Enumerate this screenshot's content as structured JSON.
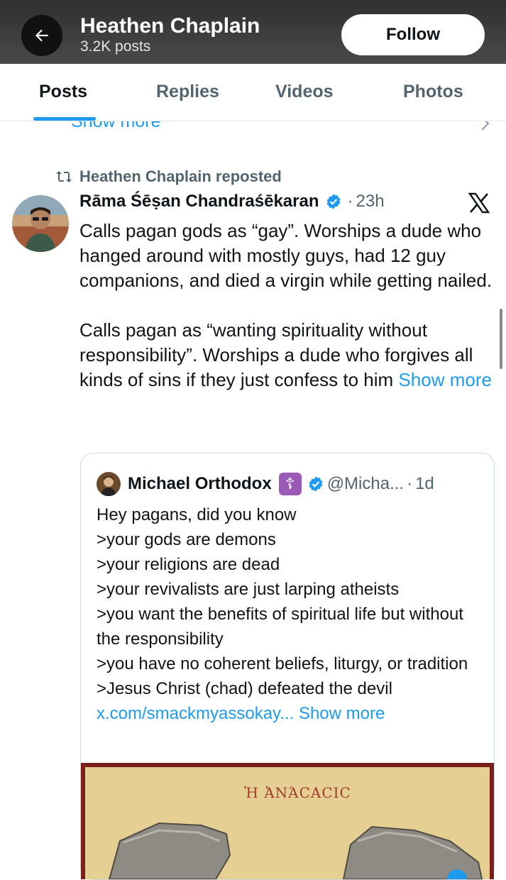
{
  "header": {
    "title": "Heathen Chaplain",
    "subtitle": "3.2K posts",
    "follow_label": "Follow"
  },
  "tabs": [
    {
      "label": "Posts",
      "active": true
    },
    {
      "label": "Replies"
    },
    {
      "label": "Videos"
    },
    {
      "label": "Photos"
    }
  ],
  "prev_post": {
    "show_more": "Show more"
  },
  "post": {
    "repost_label": "Heathen Chaplain reposted",
    "author": "Rāma Śēṣan Chandraśēkaran",
    "time": "23h",
    "text_p1": "Calls pagan gods as “gay”. Worships a dude who hanged around with mostly guys, had 12 guy companions, and died a virgin while getting nailed.",
    "text_p2": "Calls pagan as “wanting spirituality without responsibility”. Worships a dude who forgives all kinds of sins if they just confess to him",
    "show_more": "Show more",
    "quote": {
      "author": "Michael Orthodox",
      "badge": "☦",
      "handle": "@Micha...",
      "time": "1d",
      "lines": [
        "Hey pagans, did you know",
        ">your gods are demons",
        ">your religions are dead",
        ">your revivalists are just larping atheists",
        ">you want the benefits of spiritual life but without the responsibility",
        ">you have no coherent beliefs, liturgy, or tradition",
        ">Jesus Christ (chad) defeated the devil"
      ],
      "link": "x.com/smackmyassokay...",
      "show_more": "Show more",
      "image_caption": "Ἡ ἈΝΆϹΑϹΙϹ"
    }
  },
  "colors": {
    "accent": "#1d9bf0",
    "muted": "#536471",
    "badge": "#9b59b6"
  },
  "icons": [
    "back-arrow-icon",
    "repost-icon",
    "verified-badge-icon",
    "x-logo-icon",
    "chevron-right-icon"
  ]
}
